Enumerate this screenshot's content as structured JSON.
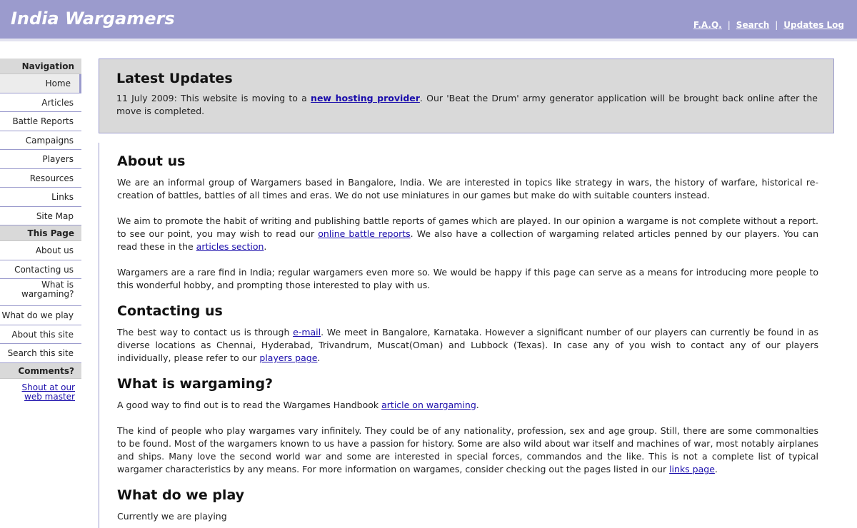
{
  "header": {
    "site_title": "India Wargamers",
    "links": [
      "F.A.Q.",
      "Search",
      "Updates Log"
    ],
    "separator": "|"
  },
  "sidebar": {
    "navigation_heading": "Navigation",
    "nav_items": [
      "Home",
      "Articles",
      "Battle Reports",
      "Campaigns",
      "Players",
      "Resources",
      "Links",
      "Site Map"
    ],
    "this_page_heading": "This Page",
    "page_items": [
      "About us",
      "Contacting us",
      "What is wargaming?",
      "What do we play",
      "About this site",
      "Search this site"
    ],
    "comments_heading": "Comments?",
    "comment_link": "Shout at our web master"
  },
  "updates": {
    "title": "Latest Updates",
    "text_before": "11 July 2009: This website is moving to a ",
    "link": "new hosting provider",
    "text_after": ". Our 'Beat the Drum' army generator application will be brought back online after the move is completed."
  },
  "about": {
    "heading": "About us",
    "p1": "We are an informal group of Wargamers based in Bangalore, India. We are interested in topics like strategy in wars, the history of warfare, historical re-creation of battles, battles of all times and eras. We do not use miniatures in our games but make do with suitable counters instead.",
    "p2_before": "We aim to promote the habit of writing and publishing battle reports of games which are played. In our opinion a wargame is not complete without a report. to see our point, you may wish to read our ",
    "p2_link1": "online battle reports",
    "p2_middle": ". We also have a collection of wargaming related articles penned by our players. You can read these in the ",
    "p2_link2": "articles section",
    "p2_after": ".",
    "p3": "Wargamers are a rare find in India; regular wargamers even more so. We would be happy if this page can serve as a means for introducing more people to this wonderful hobby, and prompting those interested to play with us."
  },
  "contact": {
    "heading": "Contacting us",
    "p1_before": "The best way to contact us is through ",
    "p1_link1": "e-mail",
    "p1_middle": ". We meet in Bangalore, Karnataka. However a significant number of our players can currently be found in as diverse locations as Chennai, Hyderabad, Trivandrum, Muscat(Oman) and Lubbock (Texas). In case any of you wish to contact any of our players individually, please refer to our ",
    "p1_link2": "players page",
    "p1_after": "."
  },
  "what": {
    "heading": "What is wargaming?",
    "p1_before": "A good way to find out is to read the Wargames Handbook ",
    "p1_link": "article on wargaming",
    "p1_after": ".",
    "p2_before": "The kind of people who play wargames vary infinitely. They could be of any nationality, profession, sex and age group. Still, there are some commonalties to be found. Most of the wargamers known to us have a passion for history. Some are also wild about war itself and machines of war, most notably airplanes and ships. Many love the second world war and some are interested in special forces, commandos and the like. This is not a complete list of typical wargamer characteristics by any means. For more information on wargames, consider checking out the pages listed in our ",
    "p2_link": "links page",
    "p2_after": "."
  },
  "play": {
    "heading": "What do we play",
    "p1": "Currently we are playing"
  }
}
